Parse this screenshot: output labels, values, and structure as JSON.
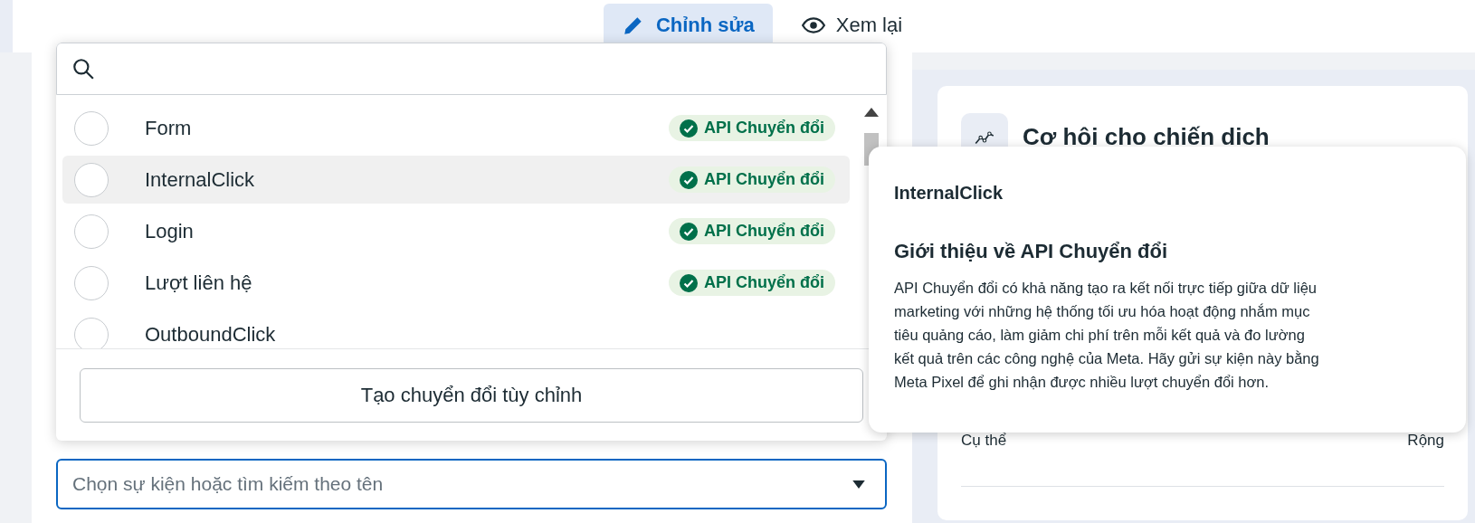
{
  "tabs": [
    {
      "label": "Chỉnh sửa",
      "kind": "pencil",
      "selected": true
    },
    {
      "label": "Xem lại",
      "kind": "eye",
      "selected": false
    }
  ],
  "event_picker": {
    "items": [
      {
        "name": "Form",
        "badge": "API Chuyển đổi",
        "selected": false,
        "highlighted": false
      },
      {
        "name": "InternalClick",
        "badge": "API Chuyển đổi",
        "selected": false,
        "highlighted": true
      },
      {
        "name": "Login",
        "badge": "API Chuyển đổi",
        "selected": false,
        "highlighted": false
      },
      {
        "name": "Lượt liên hệ",
        "badge": "API Chuyển đổi",
        "selected": false,
        "highlighted": false
      },
      {
        "name": "OutboundClick",
        "selected": false,
        "highlighted": false
      }
    ],
    "create_button": "Tạo chuyển đổi tùy chỉnh"
  },
  "tooltip": {
    "title": "InternalClick",
    "heading": "Giới thiệu về API Chuyển đổi",
    "body": "API Chuyển đổi có khả năng tạo ra kết nối trực tiếp giữa dữ liệu marketing với những hệ thống tối ưu hóa hoạt động nhắm mục tiêu quảng cáo, làm giảm chi phí trên mỗi kết quả và đo lường kết quả trên các công nghệ của Meta. Hãy gửi sự kiện này bằng Meta Pixel để ghi nhận được nhiều lượt chuyển đổi hơn."
  },
  "event_field": {
    "placeholder": "Chọn sự kiện hoặc tìm kiếm theo tên"
  },
  "opportunity_card": {
    "title": "Cơ hội cho chiến dịch",
    "scale_left": "Cụ thể",
    "scale_right": "Rộng"
  }
}
